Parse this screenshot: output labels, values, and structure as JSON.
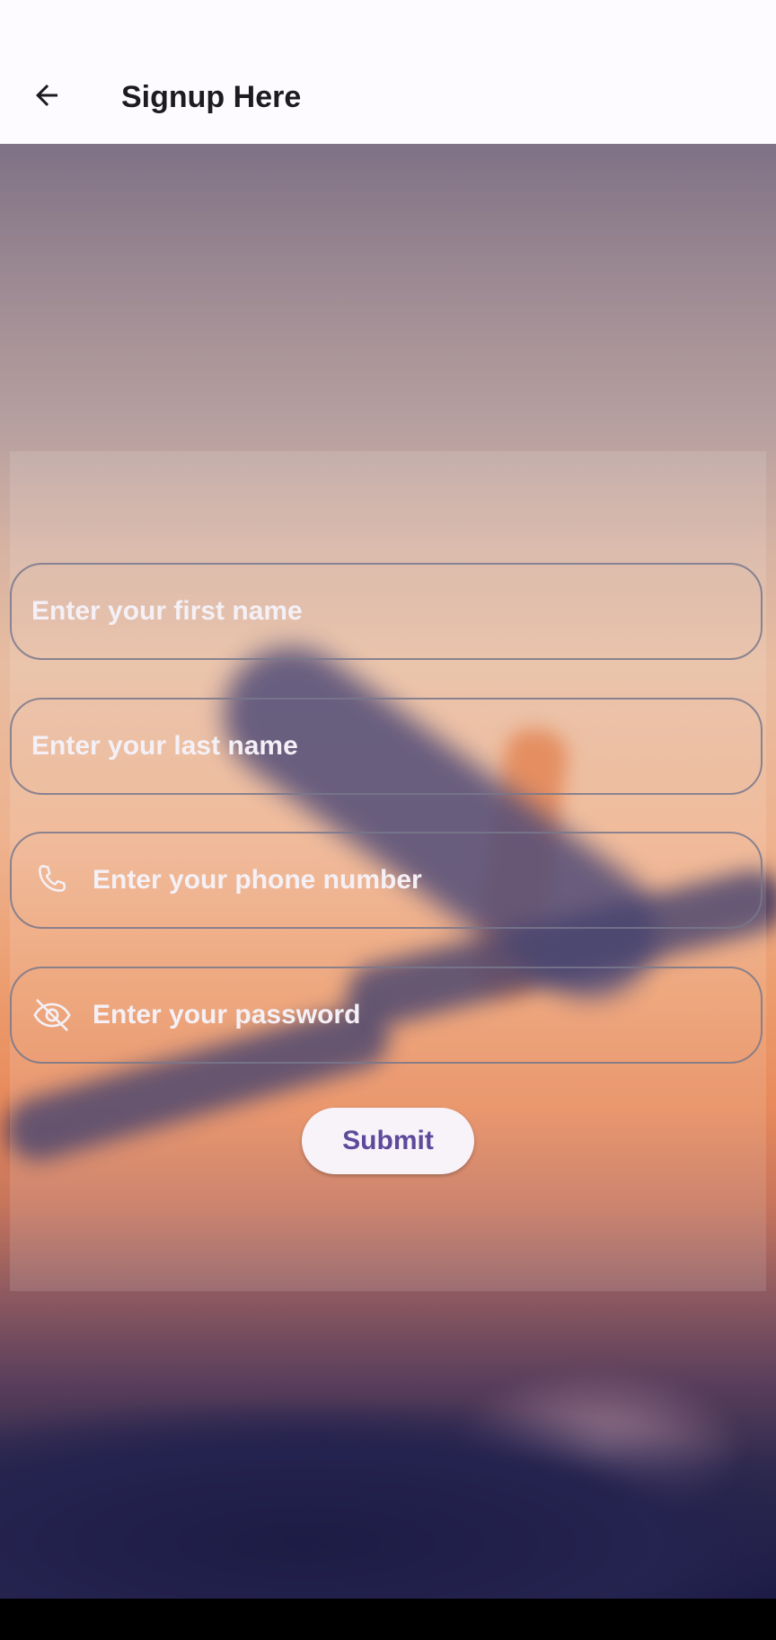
{
  "app_bar": {
    "title": "Signup Here",
    "back_icon": "arrow-left-icon"
  },
  "form": {
    "first_name": {
      "placeholder": "Enter your first name",
      "value": ""
    },
    "last_name": {
      "placeholder": "Enter your last name",
      "value": ""
    },
    "phone": {
      "placeholder": "Enter your phone number",
      "value": "",
      "icon": "phone-icon"
    },
    "password": {
      "placeholder": "Enter your password",
      "value": "",
      "icon": "eye-off-icon"
    },
    "submit_label": "Submit"
  },
  "colors": {
    "app_bar_bg": "#fdfbff",
    "title_text": "#1c1b1f",
    "placeholder_text": "#f4f0f6",
    "field_border": "#78788c",
    "submit_bg": "#f7f3f9",
    "submit_text": "#5d4a9a"
  }
}
